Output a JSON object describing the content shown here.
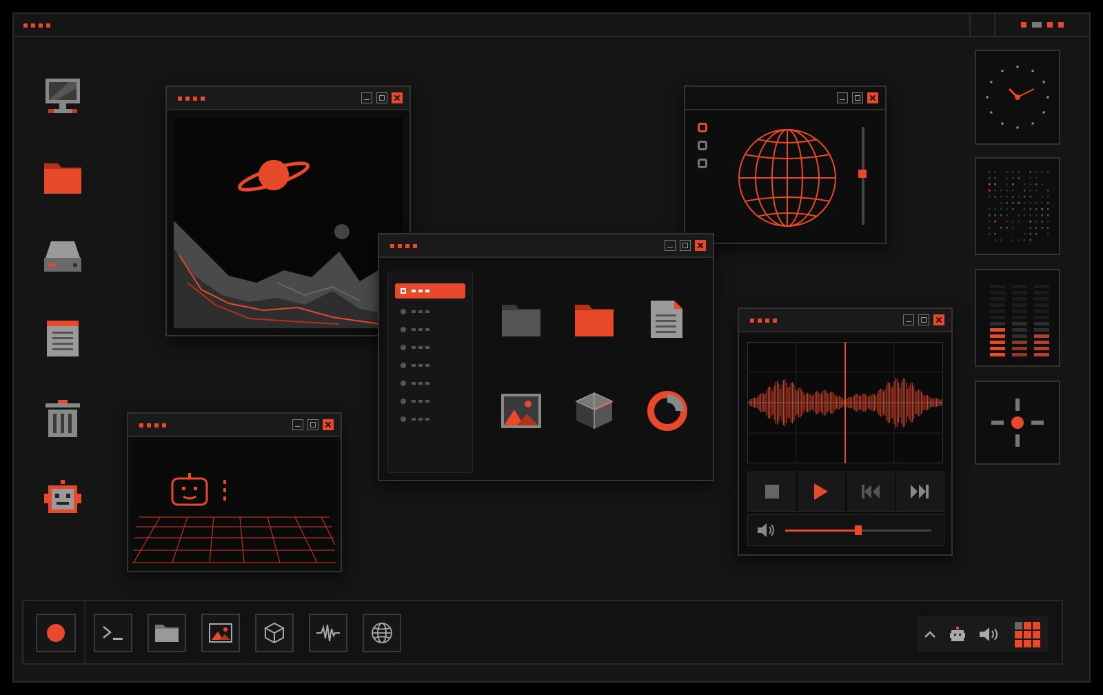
{
  "colors": {
    "accent": "#e8492a",
    "background": "#151515",
    "window": "#0d0d0d",
    "border": "#333333"
  },
  "desktop_icons": [
    {
      "name": "computer-icon"
    },
    {
      "name": "folder-icon"
    },
    {
      "name": "drive-icon"
    },
    {
      "name": "notepad-icon"
    },
    {
      "name": "trash-icon"
    },
    {
      "name": "robot-icon"
    }
  ],
  "windows": {
    "landscape": {
      "content": "planet-landscape-image"
    },
    "robot": {
      "content": "robot-grid-image"
    },
    "globe": {
      "options": [
        "radio-1",
        "radio-2",
        "radio-3"
      ],
      "slider_level": 0.45
    },
    "file_browser": {
      "sidebar_items": 8,
      "selected_index": 0,
      "files": [
        "folder-gray-icon",
        "folder-orange-icon",
        "document-icon",
        "image-icon",
        "cube-icon",
        "pie-chart-icon"
      ]
    },
    "media_player": {
      "volume": 0.5,
      "controls": [
        "stop-icon",
        "play-icon",
        "previous-icon",
        "next-icon"
      ]
    }
  },
  "widgets": [
    "clock-widget",
    "dot-matrix-widget",
    "equalizer-widget",
    "crosshair-widget"
  ],
  "taskbar": {
    "apps": [
      "record-icon",
      "terminal-icon",
      "folder-icon",
      "image-icon",
      "cube-icon",
      "waveform-icon",
      "globe-icon"
    ],
    "tray": [
      "chevron-up-icon",
      "robot-icon",
      "volume-icon",
      "grid-icon"
    ]
  }
}
